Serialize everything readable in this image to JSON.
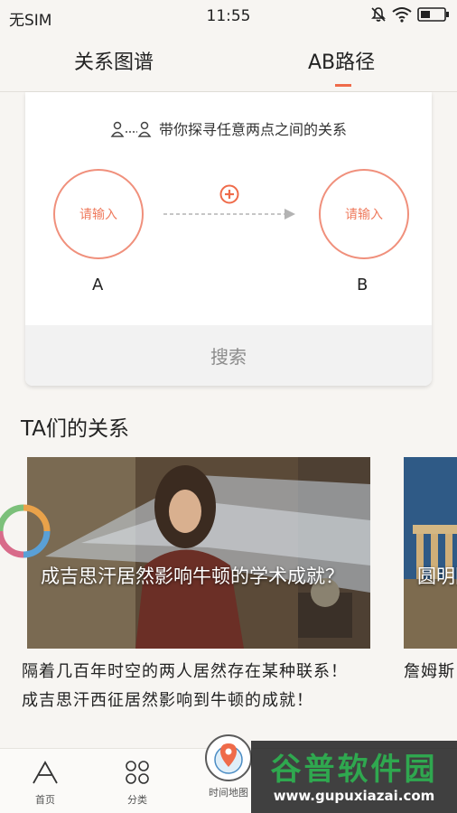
{
  "status_bar": {
    "carrier": "无SIM",
    "time": "11:55",
    "icons": [
      "mute-bell-icon",
      "wifi-icon",
      "battery-icon"
    ]
  },
  "tabs": [
    {
      "label": "关系图谱",
      "active": false
    },
    {
      "label": "AB路径",
      "active": true
    }
  ],
  "search_card": {
    "hint": "带你探寻任意两点之间的关系",
    "node_a": {
      "placeholder": "请输入",
      "label": "A"
    },
    "node_b": {
      "placeholder": "请输入",
      "label": "B"
    },
    "search_button": "搜索"
  },
  "section_title": "TA们的关系",
  "stories": [
    {
      "caption": "成吉思汗居然影响牛顿的学术成就？",
      "description": "隔着几百年时空的两人居然存在某种联系！成吉思汗西征居然影响到牛顿的成就！",
      "image": "newton-illustration"
    },
    {
      "caption": "圆明园运",
      "description": "詹姆斯曾从帕特脉相传",
      "image": "greek-ruins-photo"
    }
  ],
  "bottom_nav": [
    {
      "label": "首页",
      "icon": "home-a-icon"
    },
    {
      "label": "分类",
      "icon": "four-circles-icon"
    },
    {
      "label": "时间地图",
      "icon": "map-pin-icon"
    }
  ],
  "watermark": {
    "title": "谷普软件园",
    "url": "www.gupuxiazai.com"
  },
  "colors": {
    "accent": "#ef6b4a",
    "node_border": "#f0907c",
    "background": "#f7f5f2"
  }
}
